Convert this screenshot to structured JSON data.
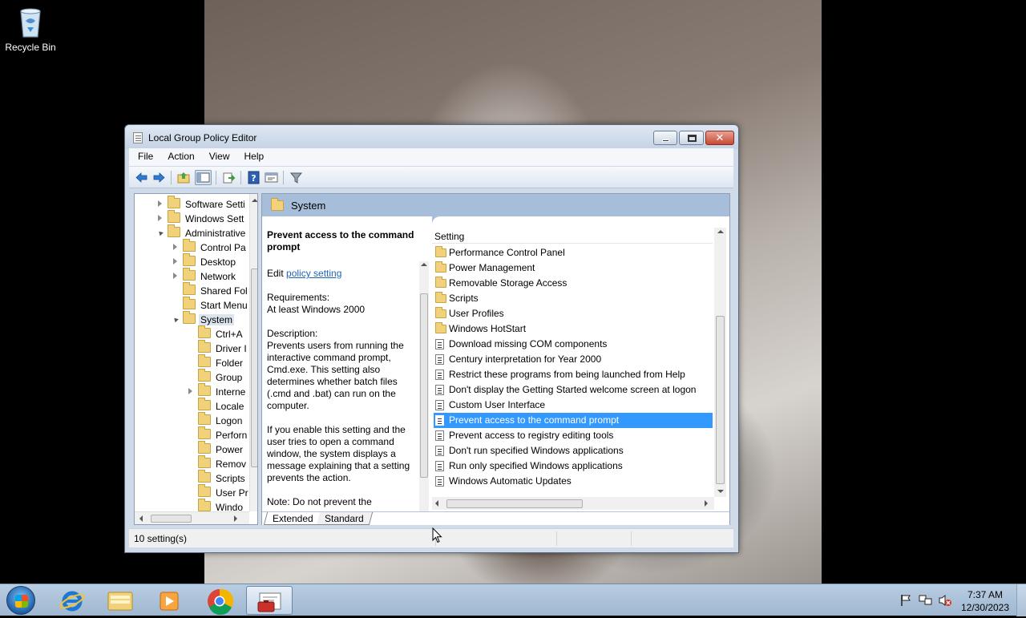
{
  "desktop": {
    "recycle_bin_label": "Recycle Bin"
  },
  "window": {
    "title": "Local Group Policy Editor",
    "menu": [
      "File",
      "Action",
      "View",
      "Help"
    ],
    "close_glyph": "✕"
  },
  "tree": {
    "items": [
      {
        "label": "Software Setti",
        "depth": 0,
        "state": "collapsed"
      },
      {
        "label": "Windows Sett",
        "depth": 0,
        "state": "collapsed"
      },
      {
        "label": "Administrative",
        "depth": 0,
        "state": "expanded"
      },
      {
        "label": "Control Pa",
        "depth": 1,
        "state": "collapsed"
      },
      {
        "label": "Desktop",
        "depth": 1,
        "state": "collapsed"
      },
      {
        "label": "Network",
        "depth": 1,
        "state": "collapsed"
      },
      {
        "label": "Shared Fol",
        "depth": 1,
        "state": "none"
      },
      {
        "label": "Start Menu",
        "depth": 1,
        "state": "none"
      },
      {
        "label": "System",
        "depth": 1,
        "state": "expanded",
        "selected": true
      },
      {
        "label": "Ctrl+A",
        "depth": 2,
        "state": "none"
      },
      {
        "label": "Driver I",
        "depth": 2,
        "state": "none"
      },
      {
        "label": "Folder",
        "depth": 2,
        "state": "none"
      },
      {
        "label": "Group",
        "depth": 2,
        "state": "none"
      },
      {
        "label": "Interne",
        "depth": 2,
        "state": "collapsed"
      },
      {
        "label": "Locale",
        "depth": 2,
        "state": "none"
      },
      {
        "label": "Logon",
        "depth": 2,
        "state": "none"
      },
      {
        "label": "Perforn",
        "depth": 2,
        "state": "none"
      },
      {
        "label": "Power",
        "depth": 2,
        "state": "none"
      },
      {
        "label": "Remov",
        "depth": 2,
        "state": "none"
      },
      {
        "label": "Scripts",
        "depth": 2,
        "state": "none"
      },
      {
        "label": "User Pr",
        "depth": 2,
        "state": "none"
      },
      {
        "label": "Windo",
        "depth": 2,
        "state": "none"
      }
    ]
  },
  "right": {
    "header": "System",
    "description": {
      "title": "Prevent access to the command prompt",
      "edit_prefix": "Edit ",
      "edit_link": "policy setting",
      "requirements_label": "Requirements:",
      "requirements_value": "At least Windows 2000",
      "description_label": "Description:",
      "description_text": "Prevents users from running the interactive command prompt, Cmd.exe. This setting also determines whether batch files (.cmd and .bat) can run on the computer.",
      "enable_text": "If you enable this setting and the user tries to open a command window, the system displays a message explaining that a setting prevents the action.",
      "note_text": "Note: Do not prevent the"
    },
    "list_header": "Setting",
    "settings": [
      {
        "label": "Performance Control Panel",
        "type": "folder"
      },
      {
        "label": "Power Management",
        "type": "folder"
      },
      {
        "label": "Removable Storage Access",
        "type": "folder"
      },
      {
        "label": "Scripts",
        "type": "folder"
      },
      {
        "label": "User Profiles",
        "type": "folder"
      },
      {
        "label": "Windows HotStart",
        "type": "folder"
      },
      {
        "label": "Download missing COM components",
        "type": "setting"
      },
      {
        "label": "Century interpretation for Year 2000",
        "type": "setting"
      },
      {
        "label": "Restrict these programs from being launched from Help",
        "type": "setting"
      },
      {
        "label": "Don't display the Getting Started welcome screen at logon",
        "type": "setting"
      },
      {
        "label": "Custom User Interface",
        "type": "setting"
      },
      {
        "label": "Prevent access to the command prompt",
        "type": "setting",
        "selected": true
      },
      {
        "label": "Prevent access to registry editing tools",
        "type": "setting"
      },
      {
        "label": "Don't run specified Windows applications",
        "type": "setting"
      },
      {
        "label": "Run only specified Windows applications",
        "type": "setting"
      },
      {
        "label": "Windows Automatic Updates",
        "type": "setting"
      }
    ],
    "tabs": [
      "Extended",
      "Standard"
    ]
  },
  "status": {
    "text": "10 setting(s)"
  },
  "taskbar": {
    "apps": [
      "internet-explorer-icon",
      "file-explorer-icon",
      "media-player-icon",
      "chrome-icon",
      "group-policy-editor-icon"
    ],
    "time": "7:37 AM",
    "date": "12/30/2023"
  },
  "colors": {
    "selection": "#3399ff",
    "header_band": "#a6bed9",
    "link": "#1f64b4"
  }
}
